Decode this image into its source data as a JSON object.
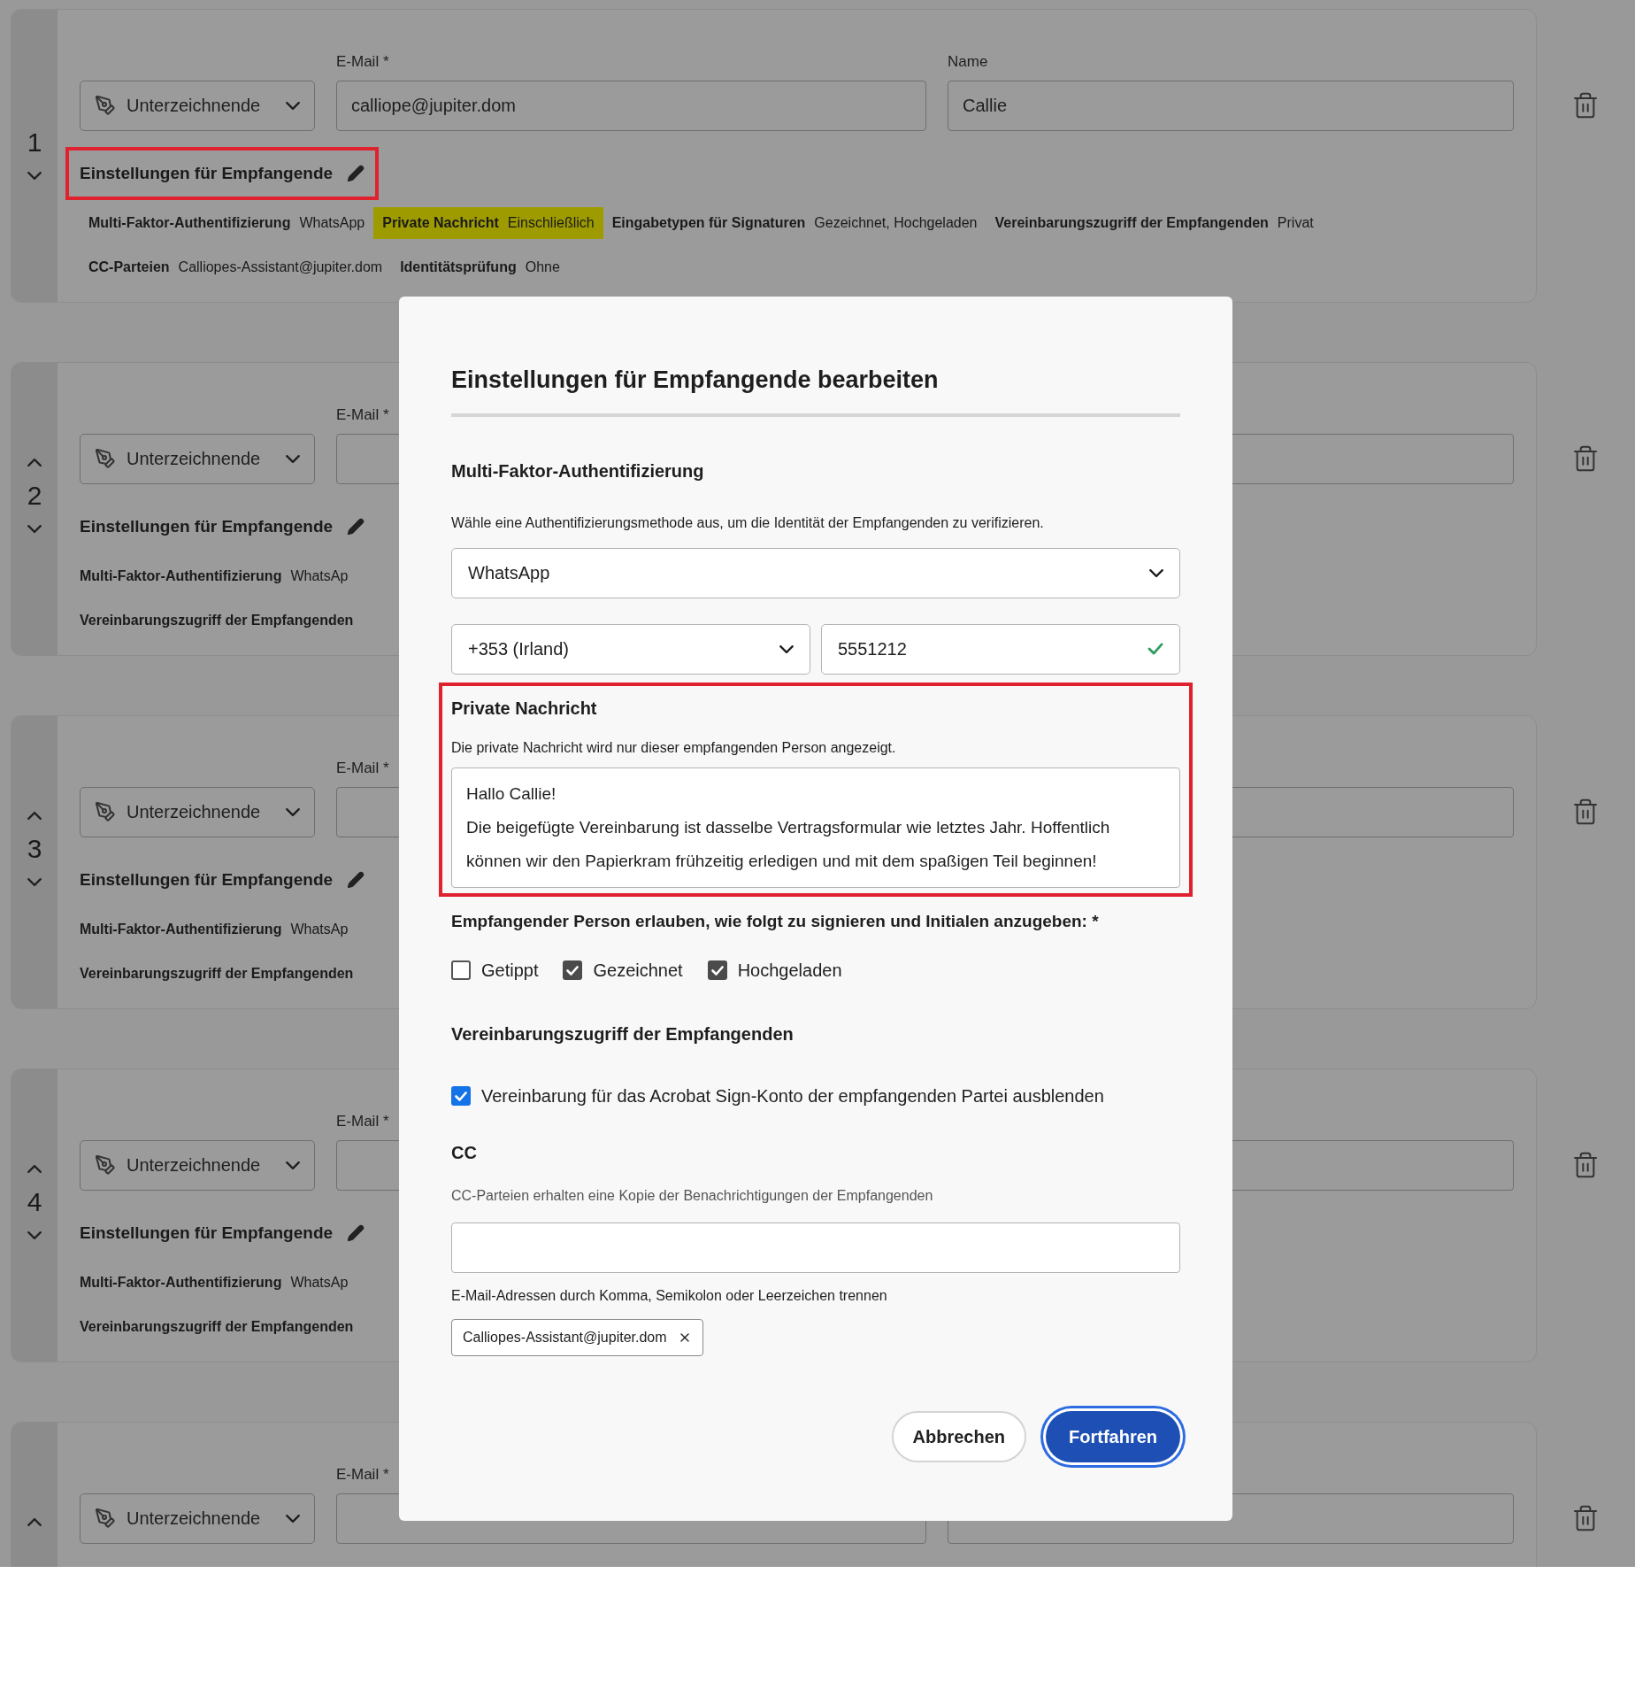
{
  "recipients": [
    {
      "number": "1",
      "can_move_up": false,
      "can_move_down": true,
      "role": "Unterzeichnende",
      "email_label": "E-Mail *",
      "email": "calliope@jupiter.dom",
      "name_label": "Name",
      "name": "Callie",
      "settings_title": "Einstellungen für Empfangende",
      "title_highlighted": true,
      "summary": [
        {
          "label": "Multi-Faktor-Authentifizierung",
          "value": "WhatsApp",
          "highlighted": false
        },
        {
          "label": "Private Nachricht",
          "value": "Einschließlich",
          "highlighted": true
        },
        {
          "label": "Eingabetypen für Signaturen",
          "value": "Gezeichnet, Hochgeladen",
          "highlighted": false
        },
        {
          "label": "Vereinbarungszugriff der Empfangenden",
          "value": "Privat",
          "highlighted": false
        },
        {
          "label": "CC-Parteien",
          "value": "Calliopes-Assistant@jupiter.dom",
          "highlighted": false
        },
        {
          "label": "Identitätsprüfung",
          "value": "Ohne",
          "highlighted": false
        }
      ]
    },
    {
      "number": "2",
      "can_move_up": true,
      "can_move_down": true,
      "role": "Unterzeichnende",
      "email_label": "E-Mail *",
      "settings_title": "Einstellungen für Empfangende",
      "title_highlighted": false,
      "summary": [
        {
          "label": "Multi-Faktor-Authentifizierung",
          "value": "WhatsAp",
          "highlighted": false
        },
        {
          "label": "Vereinbarungszugriff der Empfangenden",
          "highlighted": false
        }
      ]
    },
    {
      "number": "3",
      "can_move_up": true,
      "can_move_down": true,
      "role": "Unterzeichnende",
      "email_label": "E-Mail *",
      "settings_title": "Einstellungen für Empfangende",
      "title_highlighted": false,
      "summary": [
        {
          "label": "Multi-Faktor-Authentifizierung",
          "value": "WhatsAp",
          "highlighted": false
        },
        {
          "label": "Vereinbarungszugriff der Empfangenden",
          "highlighted": false
        }
      ]
    },
    {
      "number": "4",
      "can_move_up": true,
      "can_move_down": true,
      "role": "Unterzeichnende",
      "email_label": "E-Mail *",
      "settings_title": "Einstellungen für Empfangende",
      "title_highlighted": false,
      "summary": [
        {
          "label": "Multi-Faktor-Authentifizierung",
          "value": "WhatsAp",
          "highlighted": false
        },
        {
          "label": "Vereinbarungszugriff der Empfangenden",
          "highlighted": false
        }
      ]
    },
    {
      "can_move_up": true,
      "can_move_down": false,
      "role": "Unterzeichnende",
      "email_label": "E-Mail *"
    }
  ],
  "dialog": {
    "title": "Einstellungen für Empfangende bearbeiten",
    "mfa": {
      "heading": "Multi-Faktor-Authentifizierung",
      "description": "Wähle eine Authentifizierungsmethode aus, um die Identität der Empfangenden zu verifizieren.",
      "method": "WhatsApp",
      "country": "+353 (Irland)",
      "phone": "5551212",
      "phone_valid": true
    },
    "private_message": {
      "heading": "Private Nachricht",
      "description": "Die private Nachricht wird nur dieser empfangenden Person angezeigt.",
      "highlighted": true,
      "text": "Hallo Callie!\nDie beigefügte Vereinbarung ist dasselbe Vertragsformular wie letztes Jahr. Hoffentlich können wir den Papierkram frühzeitig erledigen und mit dem spaßigen Teil beginnen!"
    },
    "signature_types": {
      "heading": "Empfangender Person erlauben, wie folgt zu signieren und Initialen anzugeben: *",
      "options": [
        {
          "label": "Getippt",
          "checked": false
        },
        {
          "label": "Gezeichnet",
          "checked": true
        },
        {
          "label": "Hochgeladen",
          "checked": true
        }
      ]
    },
    "access": {
      "heading": "Vereinbarungszugriff der Empfangenden",
      "option": {
        "label": "Vereinbarung für das Acrobat Sign-Konto der empfangenden Partei ausblenden",
        "checked": true
      }
    },
    "cc": {
      "heading": "CC",
      "description": "CC-Parteien erhalten eine Kopie der Benachrichtigungen der Empfangenden",
      "helper": "E-Mail-Adressen durch Komma, Semikolon oder Leerzeichen trennen",
      "tags": [
        "Calliopes-Assistant@jupiter.dom"
      ]
    },
    "buttons": [
      {
        "label": "Abbrechen",
        "kind": "secondary",
        "focused": false
      },
      {
        "label": "Fortfahren",
        "kind": "primary",
        "focused": true
      }
    ]
  }
}
